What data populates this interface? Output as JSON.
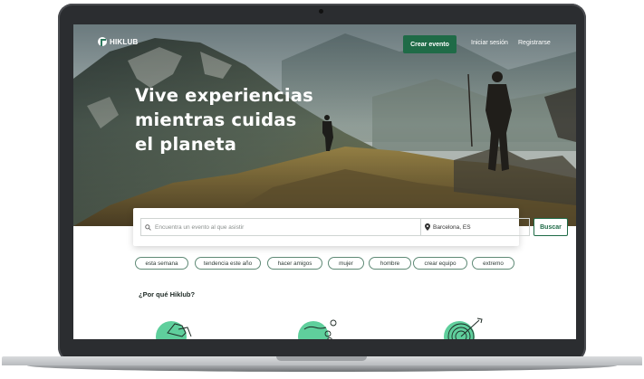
{
  "brand": {
    "name": "HIKLUB"
  },
  "nav": {
    "create_event": "Crear evento",
    "login": "Iniciar sesión",
    "register": "Registrarse"
  },
  "hero": {
    "title_lines": [
      "Vive experiencias",
      "mientras cuidas",
      "el planeta"
    ]
  },
  "search": {
    "placeholder": "Encuentra un evento al que asistir",
    "location": "Barcelona, ES",
    "button": "Buscar"
  },
  "tags": [
    "esta semana",
    "tendencia este año",
    "hacer amigos",
    "mujer",
    "hombre",
    "crear equipo",
    "extremo"
  ],
  "why": {
    "title": "¿Por qué Hiklub?"
  },
  "features": [
    {
      "icon": "friends-illustration-icon"
    },
    {
      "icon": "planet-illustration-icon"
    },
    {
      "icon": "target-illustration-icon"
    }
  ],
  "colors": {
    "primary": "#1f6b47",
    "accent_green": "#5fcf9c",
    "laptop_body": "#2b2d30"
  }
}
